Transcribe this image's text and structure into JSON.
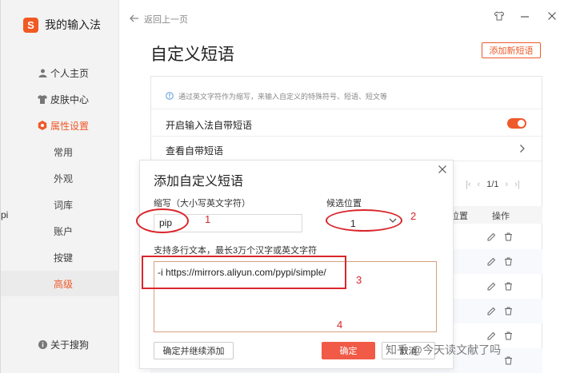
{
  "brand": {
    "logo": "S",
    "name": "我的输入法"
  },
  "sidebar": {
    "items": [
      {
        "label": "个人主页",
        "icon": "user-icon"
      },
      {
        "label": "皮肤中心",
        "icon": "shirt-icon"
      },
      {
        "label": "属性设置",
        "icon": "settings-icon"
      }
    ],
    "subitems": [
      "常用",
      "外观",
      "词库",
      "账户",
      "按键",
      "高级"
    ],
    "about": "关于搜狗"
  },
  "header": {
    "back": "返回上一页",
    "title": "自定义短语",
    "add_button": "添加新短语"
  },
  "settings": {
    "hint": "通过英文字符作为缩写，来输入自定义的特殊符号、短语、短文等",
    "toggle_label": "开启输入法自带短语",
    "view_label": "查看自带短语"
  },
  "pager": {
    "text": "1/1"
  },
  "table": {
    "col_position": "位置",
    "col_actions": "操作"
  },
  "dialog": {
    "title": "添加自定义短语",
    "abbr_label": "缩写（大小写英文字符）",
    "abbr_value": "pip",
    "position_label": "候选位置",
    "position_value": "1",
    "text_label": "支持多行文本，最长3万个汉字或英文字符",
    "text_value": "-i    https://mirrors.aliyun.com/pypi/simple/",
    "continue_button": "确定并继续添加",
    "ok_button": "确定",
    "cancel_button": "取消"
  },
  "annotations": [
    "1",
    "2",
    "3",
    "4"
  ],
  "watermark": "知乎 @今天读文献了吗",
  "edge_fragment": "pi",
  "colors": {
    "accent": "#ee5a2a",
    "ok_button": "#f05a46",
    "annotation": "#d9262c"
  }
}
